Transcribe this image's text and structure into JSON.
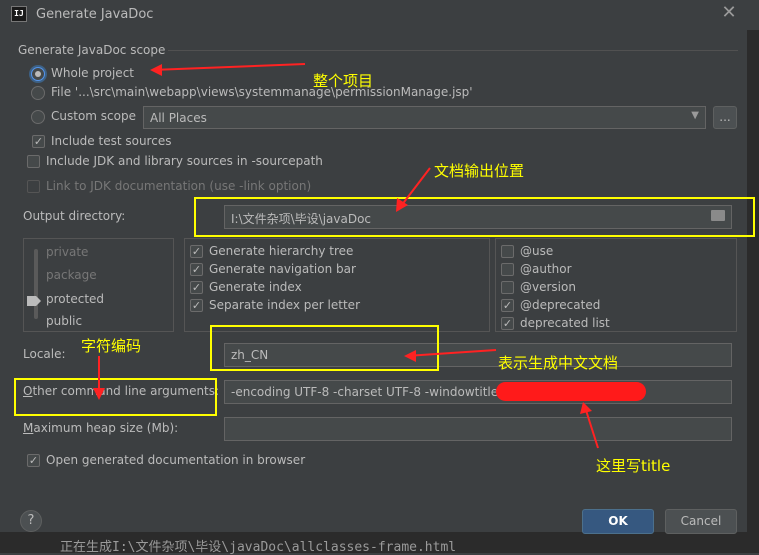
{
  "window": {
    "title": "Generate JavaDoc",
    "app_icon_text": "IJ"
  },
  "scope": {
    "section_title": "Generate JavaDoc scope",
    "whole_project": "Whole project",
    "file": "File '...\\src\\main\\webapp\\views\\systemmanage\\permissionManage.jsp'",
    "custom_scope": "Custom scope",
    "custom_scope_value": "All Places",
    "browse_label": "...",
    "include_test": "Include test sources",
    "include_test_checked": true,
    "include_jdk": "Include JDK and library sources in -sourcepath",
    "include_jdk_checked": false,
    "link_jdk": "Link to JDK documentation (use -link option)",
    "link_jdk_checked": false
  },
  "output": {
    "label": "Output directory:",
    "value": "I:\\文件杂项\\毕设\\javaDoc"
  },
  "visibility": {
    "levels": [
      "private",
      "package",
      "protected",
      "public"
    ],
    "selected": "protected"
  },
  "options": {
    "middle": [
      {
        "label": "Generate hierarchy tree",
        "checked": true
      },
      {
        "label": "Generate navigation bar",
        "checked": true
      },
      {
        "label": "Generate index",
        "checked": true
      },
      {
        "label": "Separate index per letter",
        "checked": true
      }
    ],
    "right": [
      {
        "label": "@use",
        "checked": false
      },
      {
        "label": "@author",
        "checked": false
      },
      {
        "label": "@version",
        "checked": false
      },
      {
        "label": "@deprecated",
        "checked": true
      },
      {
        "label": "deprecated list",
        "checked": true
      }
    ]
  },
  "locale": {
    "label": "Locale:",
    "value": "zh_CN"
  },
  "other_args": {
    "label": "Other command line arguments:",
    "value": "-encoding UTF-8 -charset UTF-8 -windowtitle \""
  },
  "heap": {
    "label": "Maximum heap size (Mb):",
    "value": ""
  },
  "open_browser": {
    "label": "Open generated documentation in browser",
    "checked": true
  },
  "buttons": {
    "help": "?",
    "ok": "OK",
    "cancel": "Cancel"
  },
  "annotations": {
    "whole_project_note": "整个项目",
    "output_note": "文档输出位置",
    "locale_note": "字符编码",
    "chinese_note": "表示生成中文文档",
    "title_note": "这里写title"
  },
  "background_console_text": "正在生成I:\\文件杂项\\毕设\\javaDoc\\allclasses-frame.html",
  "colors": {
    "annotation": "#ffff00",
    "arrow": "#ff2222",
    "accent": "#365880"
  }
}
